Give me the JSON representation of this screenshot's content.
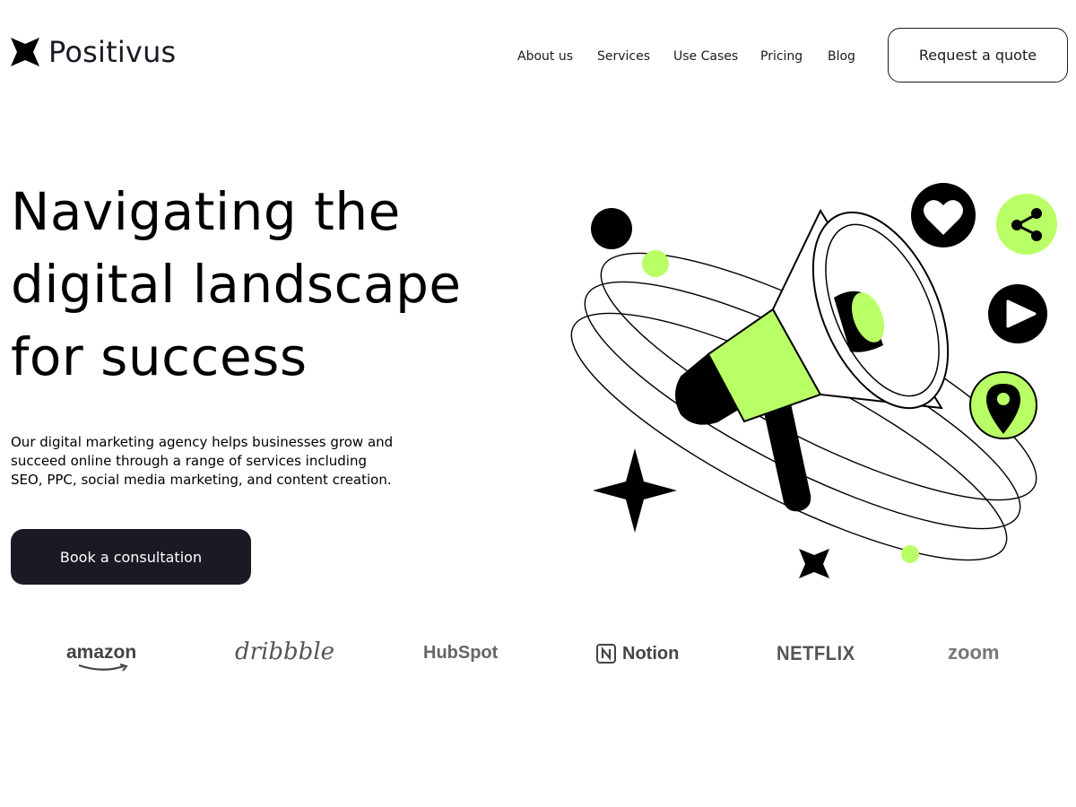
{
  "brand": {
    "name": "Positivus"
  },
  "nav": {
    "items": [
      "About us",
      "Services",
      "Use Cases",
      "Pricing",
      "Blog"
    ],
    "cta_label": "Request a quote"
  },
  "hero": {
    "title_lines": [
      "Navigating the",
      "digital landscape",
      "for success"
    ],
    "description_lines": [
      "Our digital marketing agency helps businesses grow and",
      "succeed online through a range of services including",
      "SEO, PPC, social media marketing, and content creation."
    ],
    "cta_label": "Book a consultation"
  },
  "partners": {
    "logos": [
      "amazon",
      "dribbble",
      "HubSpot",
      "Notion",
      "NETFLIX",
      "zoom"
    ]
  },
  "colors": {
    "accent": "#B9FF66",
    "dark": "#191A23",
    "muted": "#6b6b6b"
  },
  "icons": [
    "logo-star-icon",
    "megaphone-illustration",
    "heart-icon",
    "share-icon",
    "play-icon",
    "location-pin-icon",
    "sparkle-star-icon"
  ]
}
